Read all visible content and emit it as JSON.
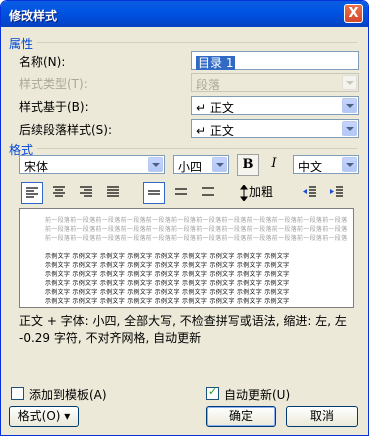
{
  "dialog": {
    "title": "修改样式",
    "close_glyph": "X"
  },
  "properties": {
    "section": "属性",
    "name_label": "名称(N):",
    "name_value": "目录 1",
    "type_label": "样式类型(T):",
    "type_value": "段落",
    "based_label": "样式基于(B):",
    "based_value": "↵ 正文",
    "next_label": "后续段落样式(S):",
    "next_value": "↵ 正文"
  },
  "format": {
    "section": "格式",
    "font": "宋体",
    "size": "小四",
    "bold": "B",
    "italic": "I",
    "script": "中文",
    "spacing_button": "加粗"
  },
  "preview": {
    "grey_line": "前一段落前一段落前一段落前一段落前一段落前一段落前一段落前一段落前一段落前一段落前一段落前一段落",
    "sample_line": "示例文字 示例文字 示例文字 示例文字 示例文字 示例文字 示例文字 示例文字 示例文字"
  },
  "description": "正文 + 字体: 小四, 全部大写, 不检查拼写或语法, 缩进: 左, 左  -0.29 字符, 不对齐网格, 自动更新",
  "footer": {
    "add_template": "添加到模板(A)",
    "auto_update": "自动更新(U)",
    "format_button": "格式(O) ▾",
    "ok": "确定",
    "cancel": "取消"
  }
}
